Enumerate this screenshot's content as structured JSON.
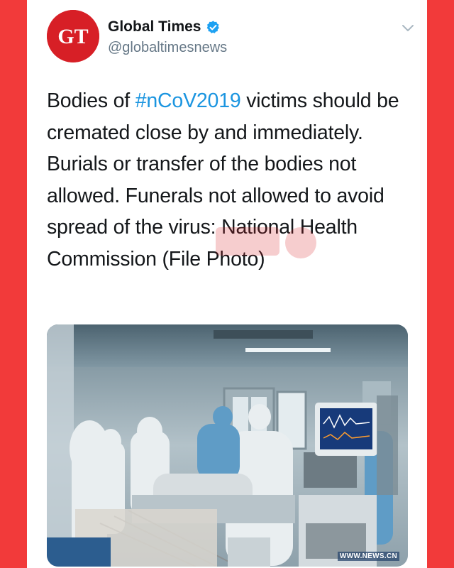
{
  "tweet": {
    "author": {
      "display_name": "Global Times",
      "handle": "@globaltimesnews",
      "avatar_text": "GT",
      "verified": true
    },
    "text_before": "Bodies of ",
    "hashtag": "#nCoV2019",
    "text_after": " victims should be cremated close by and immediately. Burials or transfer of the bodies not allowed. Funerals not allowed to avoid spread of the virus: National Health Commission (File Photo)",
    "photo": {
      "credit": "WWW.NEWS.CN"
    }
  },
  "icons": {
    "verified": "verified-badge-icon",
    "menu": "chevron-down-icon"
  },
  "colors": {
    "frame": "#f23a3a",
    "brand_red": "#d71f26",
    "hashtag": "#1b95e0",
    "verified": "#1da1f2"
  }
}
